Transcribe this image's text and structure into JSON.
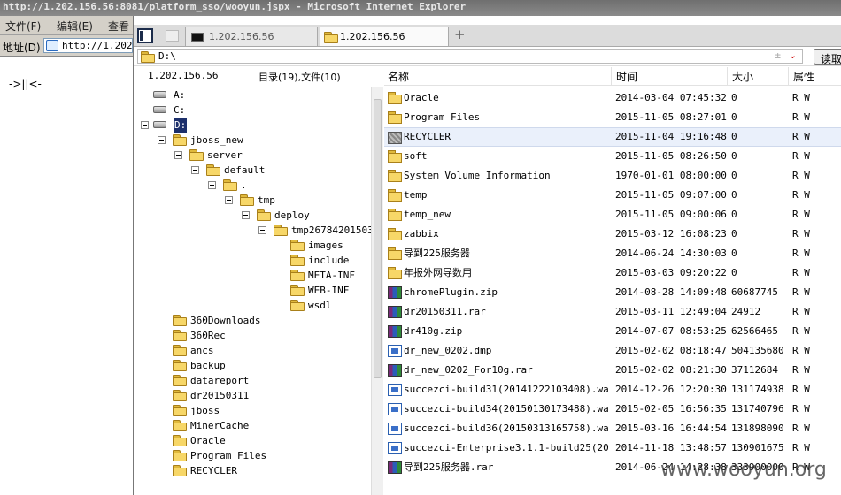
{
  "window": {
    "title": "http://1.202.156.56:8081/platform_sso/wooyun.jspx - Microsoft Internet Explorer"
  },
  "menu": {
    "file": "文件(F)",
    "edit": "编辑(E)",
    "view": "查看"
  },
  "address": {
    "label": "地址(D)",
    "value": "http://1.202."
  },
  "left_page": {
    "text": "->||<-"
  },
  "tabs": [
    {
      "label": "1.202.156.56"
    },
    {
      "label": "1.202.156.56"
    }
  ],
  "tab_add": "+",
  "path": {
    "value": "D:\\",
    "read_button": "读取",
    "clear": "±"
  },
  "tree": {
    "host": "1.202.156.56",
    "summary": "目录(19),文件(10)",
    "nodes": [
      {
        "label": "A:"
      },
      {
        "label": "C:"
      },
      {
        "label": "D:"
      },
      {
        "label": "jboss_new"
      },
      {
        "label": "server"
      },
      {
        "label": "default"
      },
      {
        "label": "."
      },
      {
        "label": "tmp"
      },
      {
        "label": "deploy"
      },
      {
        "label": "tmp2678420150357"
      },
      {
        "label": "images"
      },
      {
        "label": "include"
      },
      {
        "label": "META-INF"
      },
      {
        "label": "WEB-INF"
      },
      {
        "label": "wsdl"
      },
      {
        "label": "360Downloads"
      },
      {
        "label": "360Rec"
      },
      {
        "label": "ancs"
      },
      {
        "label": "backup"
      },
      {
        "label": "datareport"
      },
      {
        "label": "dr20150311"
      },
      {
        "label": "jboss"
      },
      {
        "label": "MinerCache"
      },
      {
        "label": "Oracle"
      },
      {
        "label": "Program Files"
      },
      {
        "label": "RECYCLER"
      }
    ]
  },
  "list": {
    "headers": {
      "name": "名称",
      "time": "时间",
      "size": "大小",
      "attr": "属性"
    },
    "rows": [
      {
        "name": "Oracle",
        "time": "2014-03-04 07:45:32",
        "size": "0",
        "attr": "R W"
      },
      {
        "name": "Program Files",
        "time": "2015-11-05 08:27:01",
        "size": "0",
        "attr": "R W"
      },
      {
        "name": "RECYCLER",
        "time": "2015-11-04 19:16:48",
        "size": "0",
        "attr": "R W"
      },
      {
        "name": "soft",
        "time": "2015-11-05 08:26:50",
        "size": "0",
        "attr": "R W"
      },
      {
        "name": "System Volume Information",
        "time": "1970-01-01 08:00:00",
        "size": "0",
        "attr": "R W"
      },
      {
        "name": "temp",
        "time": "2015-11-05 09:07:00",
        "size": "0",
        "attr": "R W"
      },
      {
        "name": "temp_new",
        "time": "2015-11-05 09:00:06",
        "size": "0",
        "attr": "R W"
      },
      {
        "name": "zabbix",
        "time": "2015-03-12 16:08:23",
        "size": "0",
        "attr": "R W"
      },
      {
        "name": "导到225服务器",
        "time": "2014-06-24 14:30:03",
        "size": "0",
        "attr": "R W"
      },
      {
        "name": "年报外网导数用",
        "time": "2015-03-03 09:20:22",
        "size": "0",
        "attr": "R W"
      },
      {
        "name": "chromePlugin.zip",
        "time": "2014-08-28 14:09:48",
        "size": "60687745",
        "attr": "R W"
      },
      {
        "name": "dr20150311.rar",
        "time": "2015-03-11 12:49:04",
        "size": "24912",
        "attr": "R W"
      },
      {
        "name": "dr410g.zip",
        "time": "2014-07-07 08:53:25",
        "size": "62566465",
        "attr": "R W"
      },
      {
        "name": "dr_new_0202.dmp",
        "time": "2015-02-02 08:18:47",
        "size": "504135680",
        "attr": "R W"
      },
      {
        "name": "dr_new_0202_For10g.rar",
        "time": "2015-02-02 08:21:30",
        "size": "37112684",
        "attr": "R W"
      },
      {
        "name": "succezci-build31(20141222103408).war",
        "time": "2014-12-26 12:20:30",
        "size": "131174938",
        "attr": "R W"
      },
      {
        "name": "succezci-build34(20150130173488).war",
        "time": "2015-02-05 16:56:35",
        "size": "131740796",
        "attr": "R W"
      },
      {
        "name": "succezci-build36(20150313165758).war",
        "time": "2015-03-16 16:44:54",
        "size": "131898090",
        "attr": "R W"
      },
      {
        "name": "succezci-Enterprise3.1.1-build25(201...",
        "time": "2014-11-18 13:48:57",
        "size": "130901675",
        "attr": "R W"
      },
      {
        "name": "导到225服务器.rar",
        "time": "2014-06-24 14:28:38",
        "size": "333900000",
        "attr": "R W"
      }
    ]
  },
  "watermark": "www.wooyun.org",
  "colors": {
    "folder": "#f7d768",
    "selected_row": "#eaf0fb",
    "titlebar": "#7a7a7a"
  }
}
